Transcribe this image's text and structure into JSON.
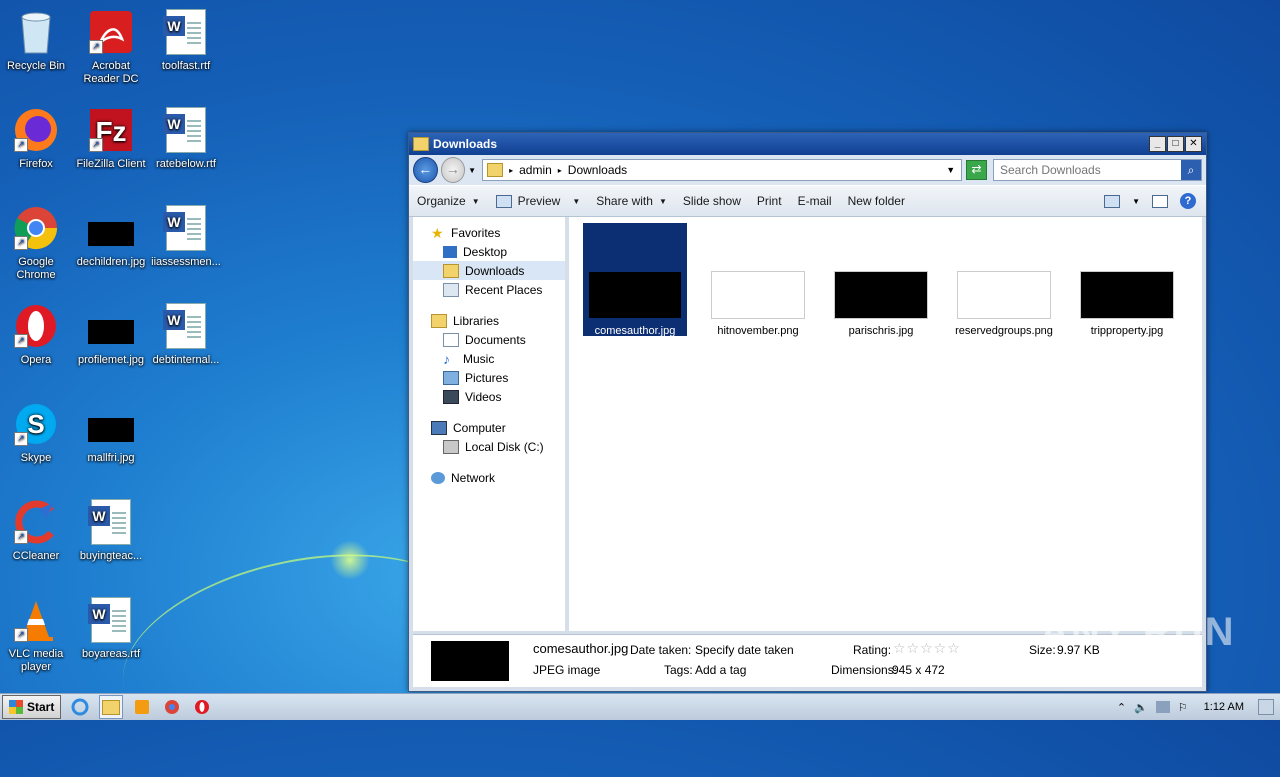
{
  "desktop": {
    "icons": [
      {
        "label": "Recycle Bin"
      },
      {
        "label": "Acrobat Reader DC"
      },
      {
        "label": "toolfast.rtf"
      },
      {
        "label": "Firefox"
      },
      {
        "label": "FileZilla Client"
      },
      {
        "label": "ratebelow.rtf"
      },
      {
        "label": "Google Chrome"
      },
      {
        "label": "dechildren.jpg"
      },
      {
        "label": "iiassessmen..."
      },
      {
        "label": "Opera"
      },
      {
        "label": "profilemet.jpg"
      },
      {
        "label": "debtinternal..."
      },
      {
        "label": "Skype"
      },
      {
        "label": "mallfri.jpg"
      },
      {
        "label": "CCleaner"
      },
      {
        "label": "buyingteac..."
      },
      {
        "label": "VLC media player"
      },
      {
        "label": "boyareas.rtf"
      }
    ],
    "watermark": "ANY RUN"
  },
  "window": {
    "title": "Downloads",
    "address": {
      "seg1": "admin",
      "seg2": "Downloads"
    },
    "search_placeholder": "Search Downloads",
    "toolbar": {
      "organize": "Organize",
      "preview": "Preview",
      "share": "Share with",
      "slideshow": "Slide show",
      "print": "Print",
      "email": "E-mail",
      "newfolder": "New folder"
    },
    "nav": {
      "favorites": "Favorites",
      "desktop": "Desktop",
      "downloads": "Downloads",
      "recent": "Recent Places",
      "libraries": "Libraries",
      "documents": "Documents",
      "music": "Music",
      "pictures": "Pictures",
      "videos": "Videos",
      "computer": "Computer",
      "localdisk": "Local Disk (C:)",
      "network": "Network"
    },
    "files": [
      {
        "name": "comesauthor.jpg"
      },
      {
        "name": "hitnovember.png"
      },
      {
        "name": "parischris.jpg"
      },
      {
        "name": "reservedgroups.png"
      },
      {
        "name": "tripproperty.jpg"
      }
    ],
    "status": {
      "filename": "comesauthor.jpg",
      "type": "JPEG image",
      "date_label": "Date taken:",
      "date_value": "Specify date taken",
      "tags_label": "Tags:",
      "tags_value": "Add a tag",
      "rating_label": "Rating:",
      "dims_label": "Dimensions:",
      "dims_value": "945 x 472",
      "size_label": "Size:",
      "size_value": "9.97 KB"
    }
  },
  "taskbar": {
    "start": "Start",
    "clock": "1:12 AM"
  }
}
